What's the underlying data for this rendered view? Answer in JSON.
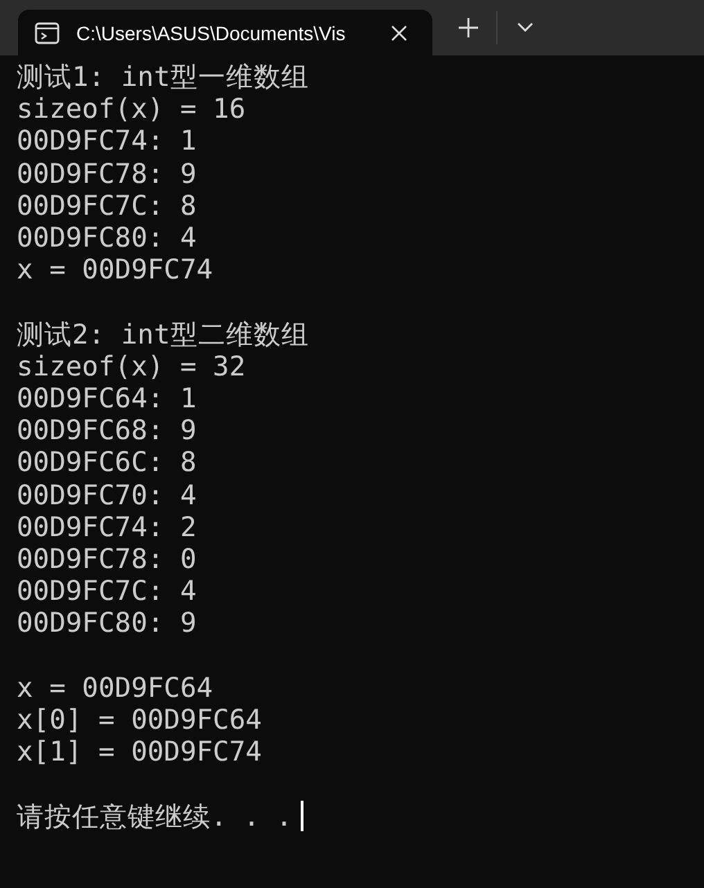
{
  "tab": {
    "title": "C:\\Users\\ASUS\\Documents\\Vis",
    "selected": true
  },
  "blocks": [
    {
      "lines": [
        "测试1: int型一维数组",
        "sizeof(x) = 16",
        "00D9FC74: 1",
        "00D9FC78: 9",
        "00D9FC7C: 8",
        "00D9FC80: 4",
        "x = 00D9FC74"
      ]
    },
    {
      "lines": [
        "测试2: int型二维数组",
        "sizeof(x) = 32",
        "00D9FC64: 1",
        "00D9FC68: 9",
        "00D9FC6C: 8",
        "00D9FC70: 4",
        "00D9FC74: 2",
        "00D9FC78: 0",
        "00D9FC7C: 4",
        "00D9FC80: 9"
      ]
    },
    {
      "lines": [
        "x = 00D9FC64",
        "x[0] = 00D9FC64",
        "x[1] = 00D9FC74"
      ]
    },
    {
      "lines": [
        "请按任意键继续. . ."
      ],
      "cursor": true
    }
  ]
}
